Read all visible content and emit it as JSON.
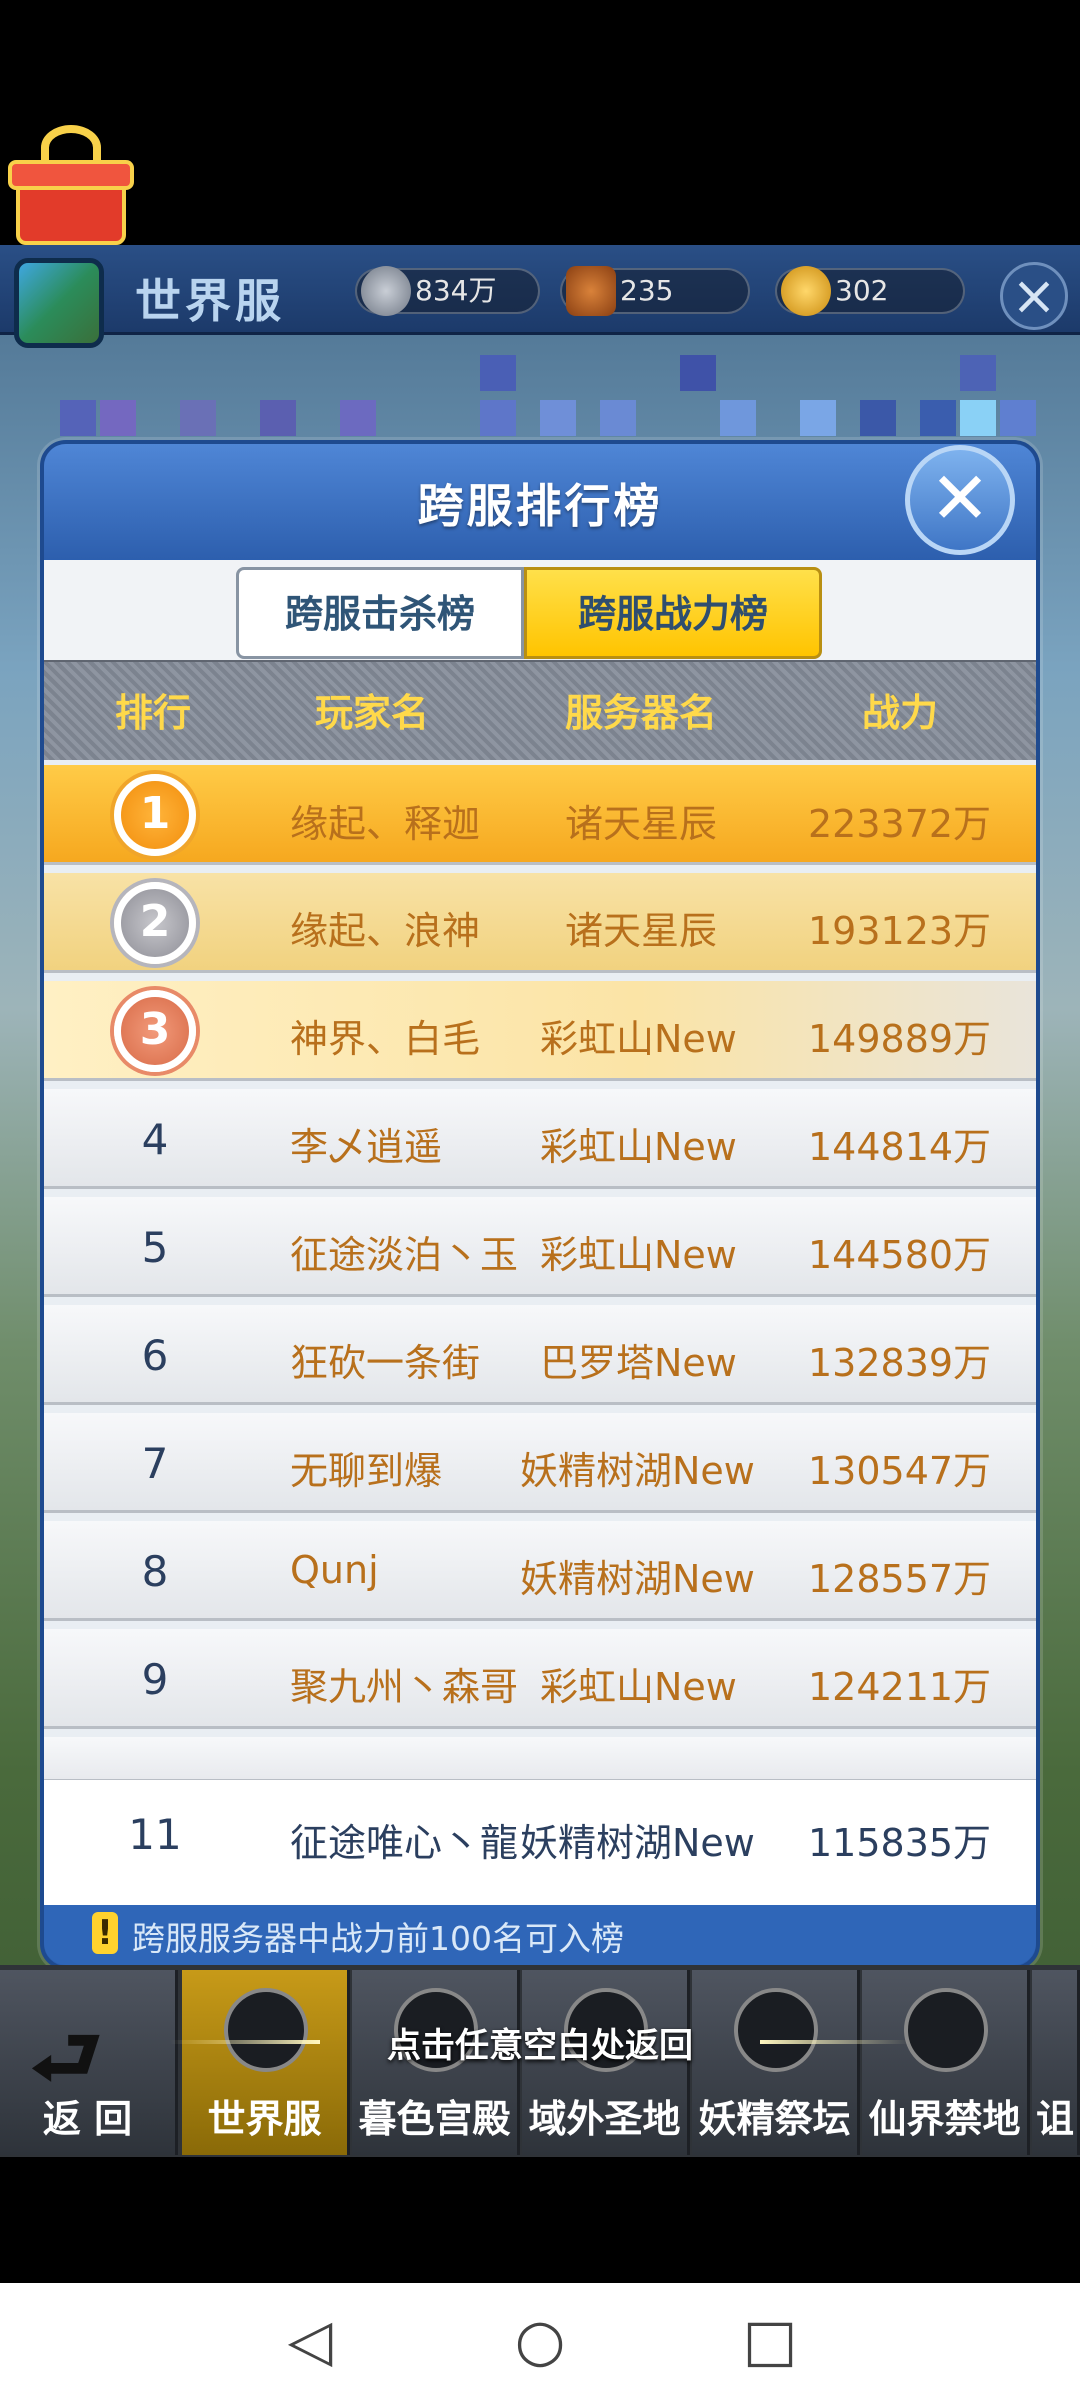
{
  "topbar": {
    "title": "世界服",
    "resources": [
      {
        "icon": "silver-coin-icon",
        "value": "834万"
      },
      {
        "icon": "hex-token-icon",
        "value": "235"
      },
      {
        "icon": "gold-coin-icon",
        "value": "302"
      }
    ],
    "close_icon": "close-icon"
  },
  "panel": {
    "title": "跨服排行榜",
    "close_label": "✕",
    "tabs": [
      {
        "label": "跨服击杀榜",
        "selected": false
      },
      {
        "label": "跨服战力榜",
        "selected": true
      }
    ],
    "headers": {
      "rank": "排行",
      "player": "玩家名",
      "server": "服务器名",
      "power": "战力"
    },
    "rows": [
      {
        "rank": "1",
        "player": "缘起、释迦",
        "server": "诸天星辰",
        "power": "223372万"
      },
      {
        "rank": "2",
        "player": "缘起、浪神",
        "server": "诸天星辰",
        "power": "193123万"
      },
      {
        "rank": "3",
        "player": "神界、白毛",
        "server": "彩虹山New",
        "power": "149889万"
      },
      {
        "rank": "4",
        "player": "李乄逍遥",
        "server": "彩虹山New",
        "power": "144814万"
      },
      {
        "rank": "5",
        "player": "征途淡泊丶玉",
        "server": "彩虹山New",
        "power": "144580万"
      },
      {
        "rank": "6",
        "player": "狂砍一条街",
        "server": "巴罗塔New",
        "power": "132839万"
      },
      {
        "rank": "7",
        "player": "无聊到爆",
        "server": "妖精树湖New",
        "power": "130547万"
      },
      {
        "rank": "8",
        "player": "Qunj",
        "server": "妖精树湖New",
        "power": "128557万"
      },
      {
        "rank": "9",
        "player": "聚九州丶森哥",
        "server": "彩虹山New",
        "power": "124211万"
      }
    ],
    "self_row": {
      "rank": "11",
      "player": "征途唯心丶龍",
      "server": "妖精树湖New",
      "power": "115835万"
    },
    "footer": "跨服服务器中战力前100名可入榜"
  },
  "bottom_nav": {
    "back_label": "返 回",
    "items": [
      {
        "label": "世界服",
        "active": true
      },
      {
        "label": "暮色宫殿",
        "active": false
      },
      {
        "label": "域外圣地",
        "active": false
      },
      {
        "label": "妖精祭坛",
        "active": false
      },
      {
        "label": "仙界禁地",
        "active": false
      },
      {
        "label": "诅",
        "active": false
      }
    ],
    "hint": "点击任意空白处返回"
  },
  "system_nav": {
    "back": "◁",
    "home": "○",
    "recent": "□"
  },
  "colors": {
    "accent_gold": "#ffc400",
    "panel_blue": "#2b5fb0",
    "header_text": "#ffd94a",
    "row_text": "#b8701c"
  }
}
